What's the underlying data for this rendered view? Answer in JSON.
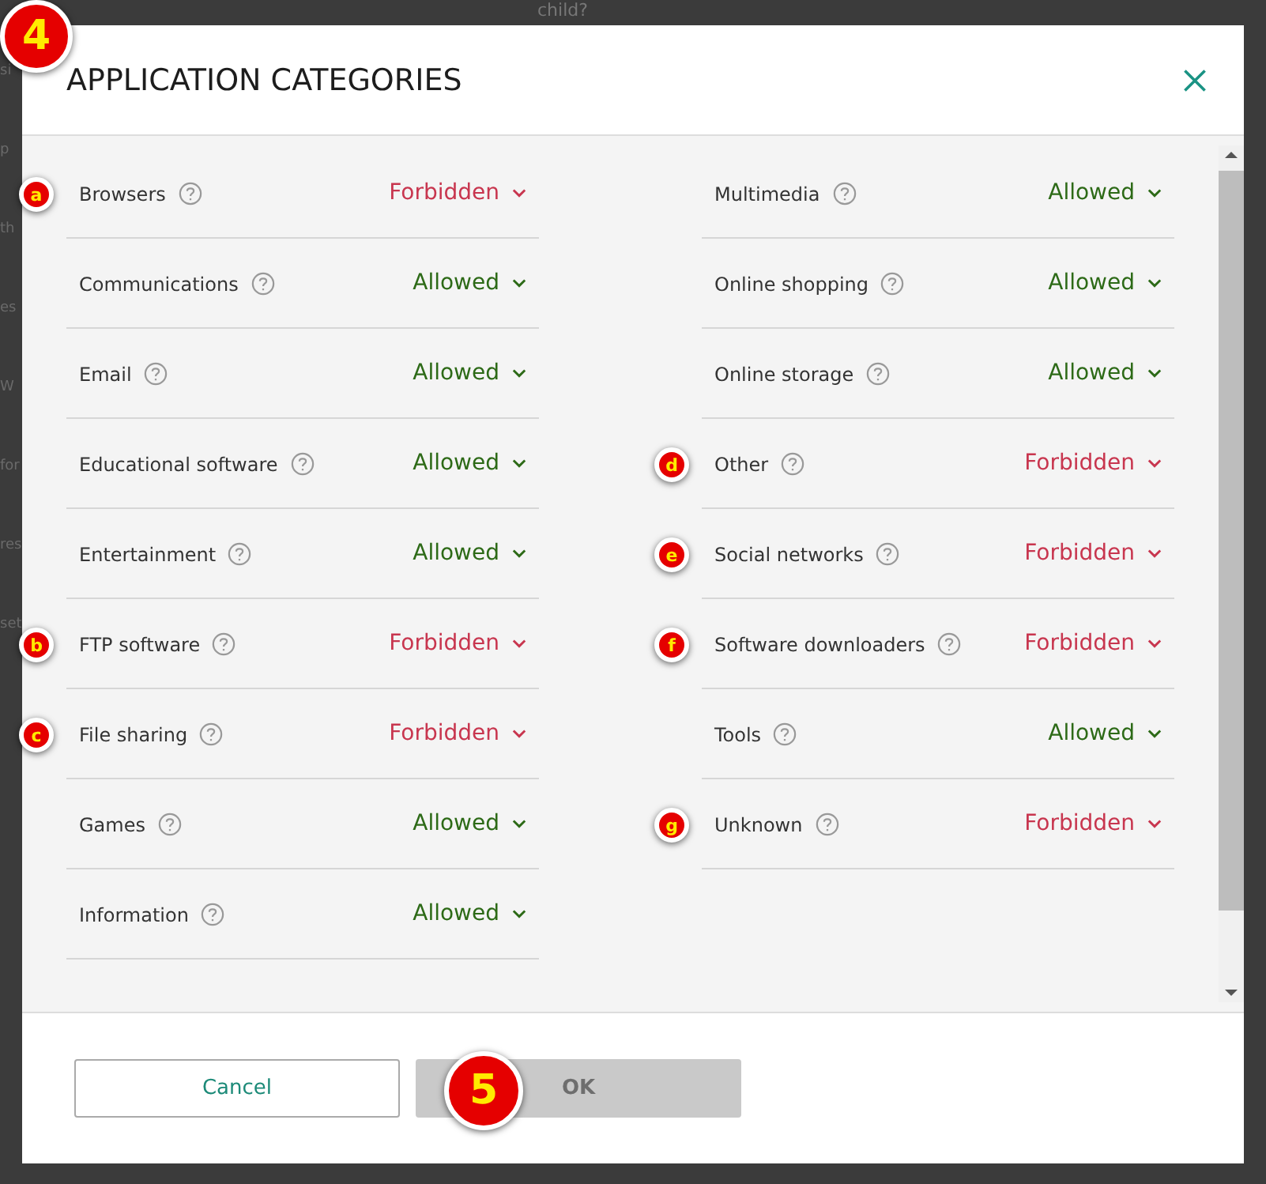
{
  "background": {
    "top_text": "child?",
    "side_texts": [
      "si",
      "p",
      "th",
      "es",
      "W",
      "for",
      "res",
      "set"
    ]
  },
  "dialog": {
    "title": "APPLICATION CATEGORIES",
    "callout": "4",
    "columns": [
      [
        {
          "name": "Browsers",
          "value": "Forbidden",
          "color": "#c8364f",
          "marker": "a"
        },
        {
          "name": "Communications",
          "value": "Allowed",
          "color": "#2d6a17"
        },
        {
          "name": "Email",
          "value": "Allowed",
          "color": "#2d6a17"
        },
        {
          "name": "Educational software",
          "value": "Allowed",
          "color": "#2d6a17"
        },
        {
          "name": "Entertainment",
          "value": "Allowed",
          "color": "#2d6a17"
        },
        {
          "name": "FTP software",
          "value": "Forbidden",
          "color": "#c8364f",
          "marker": "b"
        },
        {
          "name": "File sharing",
          "value": "Forbidden",
          "color": "#c8364f",
          "marker": "c"
        },
        {
          "name": "Games",
          "value": "Allowed",
          "color": "#2d6a17"
        },
        {
          "name": "Information",
          "value": "Allowed",
          "color": "#2d6a17"
        }
      ],
      [
        {
          "name": "Multimedia",
          "value": "Allowed",
          "color": "#2d6a17"
        },
        {
          "name": "Online shopping",
          "value": "Allowed",
          "color": "#2d6a17"
        },
        {
          "name": "Online storage",
          "value": "Allowed",
          "color": "#2d6a17"
        },
        {
          "name": "Other",
          "value": "Forbidden",
          "color": "#c8364f",
          "marker": "d"
        },
        {
          "name": "Social networks",
          "value": "Forbidden",
          "color": "#c8364f",
          "marker": "e"
        },
        {
          "name": "Software downloaders",
          "value": "Forbidden",
          "color": "#c8364f",
          "marker": "f"
        },
        {
          "name": "Tools",
          "value": "Allowed",
          "color": "#2d6a17"
        },
        {
          "name": "Unknown",
          "value": "Forbidden",
          "color": "#c8364f",
          "marker": "g"
        }
      ]
    ],
    "buttons": [
      {
        "label": "Cancel",
        "disabled": false
      },
      {
        "label": "OK",
        "disabled": true,
        "callout": "5"
      }
    ]
  }
}
